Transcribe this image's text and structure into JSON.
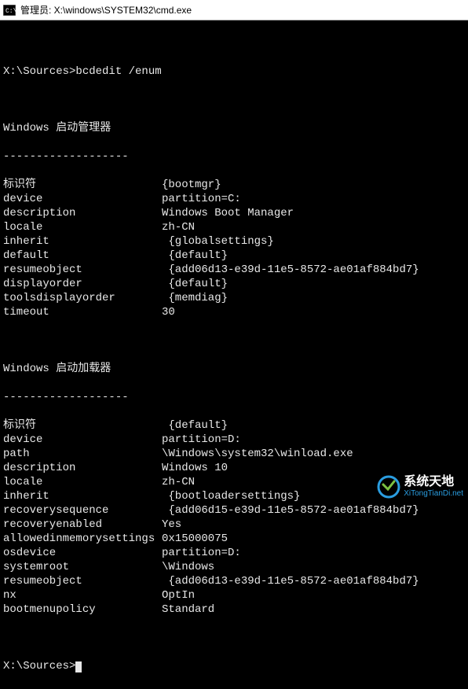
{
  "titlebar": {
    "text": "管理员: X:\\windows\\SYSTEM32\\cmd.exe"
  },
  "prompt1": "X:\\Sources>",
  "command1": "bcdedit /enum",
  "section1": {
    "title": "Windows 启动管理器",
    "divider": "-------------------",
    "rows": [
      {
        "k": "标识符",
        "v": "{bootmgr}"
      },
      {
        "k": "device",
        "v": "partition=C:"
      },
      {
        "k": "description",
        "v": "Windows Boot Manager"
      },
      {
        "k": "locale",
        "v": "zh-CN"
      },
      {
        "k": "inherit",
        "v": " {globalsettings}"
      },
      {
        "k": "default",
        "v": " {default}"
      },
      {
        "k": "resumeobject",
        "v": " {add06d13-e39d-11e5-8572-ae01af884bd7}"
      },
      {
        "k": "displayorder",
        "v": " {default}"
      },
      {
        "k": "toolsdisplayorder",
        "v": " {memdiag}"
      },
      {
        "k": "timeout",
        "v": "30"
      }
    ]
  },
  "section2": {
    "title": "Windows 启动加载器",
    "divider": "-------------------",
    "rows": [
      {
        "k": "标识符",
        "v": " {default}"
      },
      {
        "k": "device",
        "v": "partition=D:"
      },
      {
        "k": "path",
        "v": "\\Windows\\system32\\winload.exe"
      },
      {
        "k": "description",
        "v": "Windows 10"
      },
      {
        "k": "locale",
        "v": "zh-CN"
      },
      {
        "k": "inherit",
        "v": " {bootloadersettings}"
      },
      {
        "k": "recoverysequence",
        "v": " {add06d15-e39d-11e5-8572-ae01af884bd7}"
      },
      {
        "k": "recoveryenabled",
        "v": "Yes"
      },
      {
        "k": "allowedinmemorysettings",
        "v": "0x15000075"
      },
      {
        "k": "osdevice",
        "v": "partition=D:"
      },
      {
        "k": "systemroot",
        "v": "\\Windows"
      },
      {
        "k": "resumeobject",
        "v": " {add06d13-e39d-11e5-8572-ae01af884bd7}"
      },
      {
        "k": "nx",
        "v": "OptIn"
      },
      {
        "k": "bootmenupolicy",
        "v": "Standard"
      }
    ]
  },
  "prompt2": "X:\\Sources>",
  "watermark": {
    "main": "系统天地",
    "sub": "XiTongTianDi.net"
  }
}
